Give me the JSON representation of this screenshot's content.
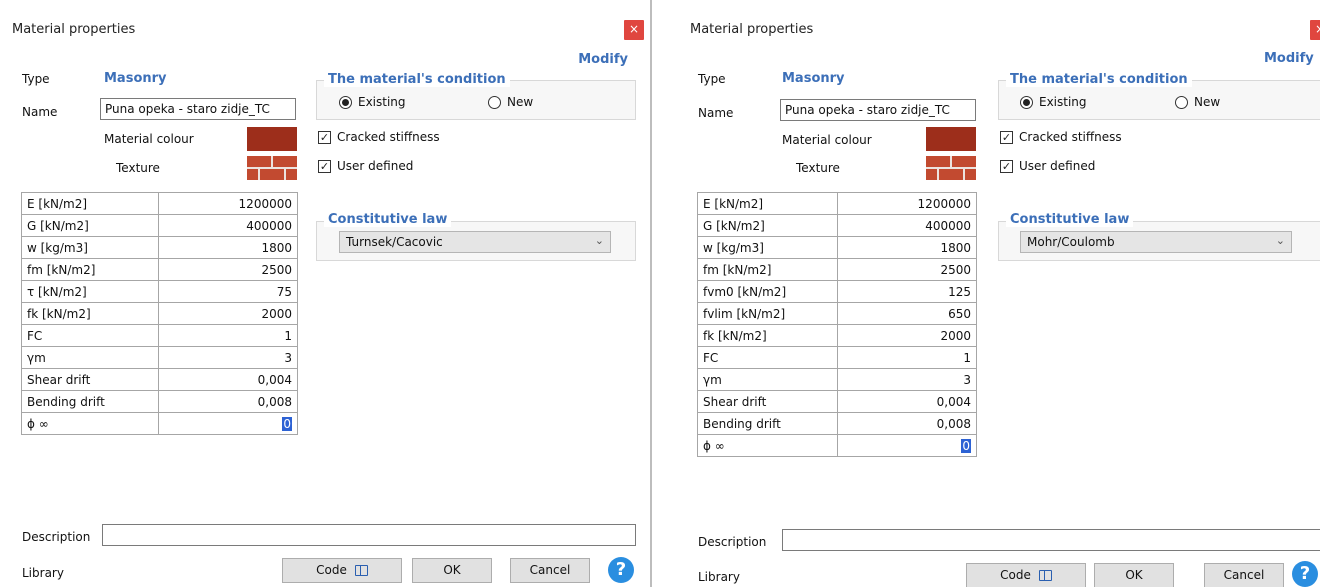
{
  "dialogs": [
    {
      "title": "Material properties",
      "close_label": "×",
      "modify_label": "Modify",
      "type_label": "Type",
      "type_value": "Masonry",
      "name_label": "Name",
      "name_value": "Puna opeka - staro zidje_TC",
      "colour_label": "Material colour",
      "texture_label": "Texture",
      "condition_title": "The material's condition",
      "existing_label": "Existing",
      "new_label": "New",
      "existing_selected": true,
      "cracked_label": "Cracked stiffness",
      "cracked_checked": true,
      "user_defined_label": "User defined",
      "user_defined_checked": true,
      "constitutive_title": "Constitutive law",
      "constitutive_value": "Turnsek/Cacovic",
      "properties": [
        {
          "name": "E [kN/m2]",
          "value": "1200000"
        },
        {
          "name": "G [kN/m2]",
          "value": "400000"
        },
        {
          "name": "w [kg/m3]",
          "value": "1800"
        },
        {
          "name": "fm [kN/m2]",
          "value": "2500"
        },
        {
          "name": "τ [kN/m2]",
          "value": "75"
        },
        {
          "name": "fk [kN/m2]",
          "value": "2000"
        },
        {
          "name": "FC",
          "value": "1"
        },
        {
          "name": "γm",
          "value": "3"
        },
        {
          "name": "Shear drift",
          "value": "0,004"
        },
        {
          "name": "Bending drift",
          "value": "0,008"
        },
        {
          "name": "ϕ ∞",
          "value": "0"
        }
      ],
      "description_label": "Description",
      "description_value": "",
      "library_label": "Library",
      "code_label": "Code",
      "ok_label": "OK",
      "cancel_label": "Cancel",
      "help_label": "?"
    },
    {
      "title": "Material properties",
      "close_label": "×",
      "modify_label": "Modify",
      "type_label": "Type",
      "type_value": "Masonry",
      "name_label": "Name",
      "name_value": "Puna opeka - staro zidje_TC",
      "colour_label": "Material colour",
      "texture_label": "Texture",
      "condition_title": "The material's condition",
      "existing_label": "Existing",
      "new_label": "New",
      "existing_selected": true,
      "cracked_label": "Cracked stiffness",
      "cracked_checked": true,
      "user_defined_label": "User defined",
      "user_defined_checked": true,
      "constitutive_title": "Constitutive law",
      "constitutive_value": "Mohr/Coulomb",
      "properties": [
        {
          "name": "E [kN/m2]",
          "value": "1200000"
        },
        {
          "name": "G [kN/m2]",
          "value": "400000"
        },
        {
          "name": "w [kg/m3]",
          "value": "1800"
        },
        {
          "name": "fm [kN/m2]",
          "value": "2500"
        },
        {
          "name": "fvm0 [kN/m2]",
          "value": "125"
        },
        {
          "name": "fvlim [kN/m2]",
          "value": "650"
        },
        {
          "name": "fk [kN/m2]",
          "value": "2000"
        },
        {
          "name": "FC",
          "value": "1"
        },
        {
          "name": "γm",
          "value": "3"
        },
        {
          "name": "Shear drift",
          "value": "0,004"
        },
        {
          "name": "Bending drift",
          "value": "0,008"
        },
        {
          "name": "ϕ ∞",
          "value": "0"
        }
      ],
      "description_label": "Description",
      "description_value": "",
      "library_label": "Library",
      "code_label": "Code",
      "ok_label": "OK",
      "cancel_label": "Cancel",
      "help_label": "?"
    }
  ],
  "colors": {
    "accent_blue": "#3c6fb8",
    "material_colour": "#9d2e1b",
    "close_red": "#e0463f",
    "help_blue": "#2a8ee0"
  }
}
